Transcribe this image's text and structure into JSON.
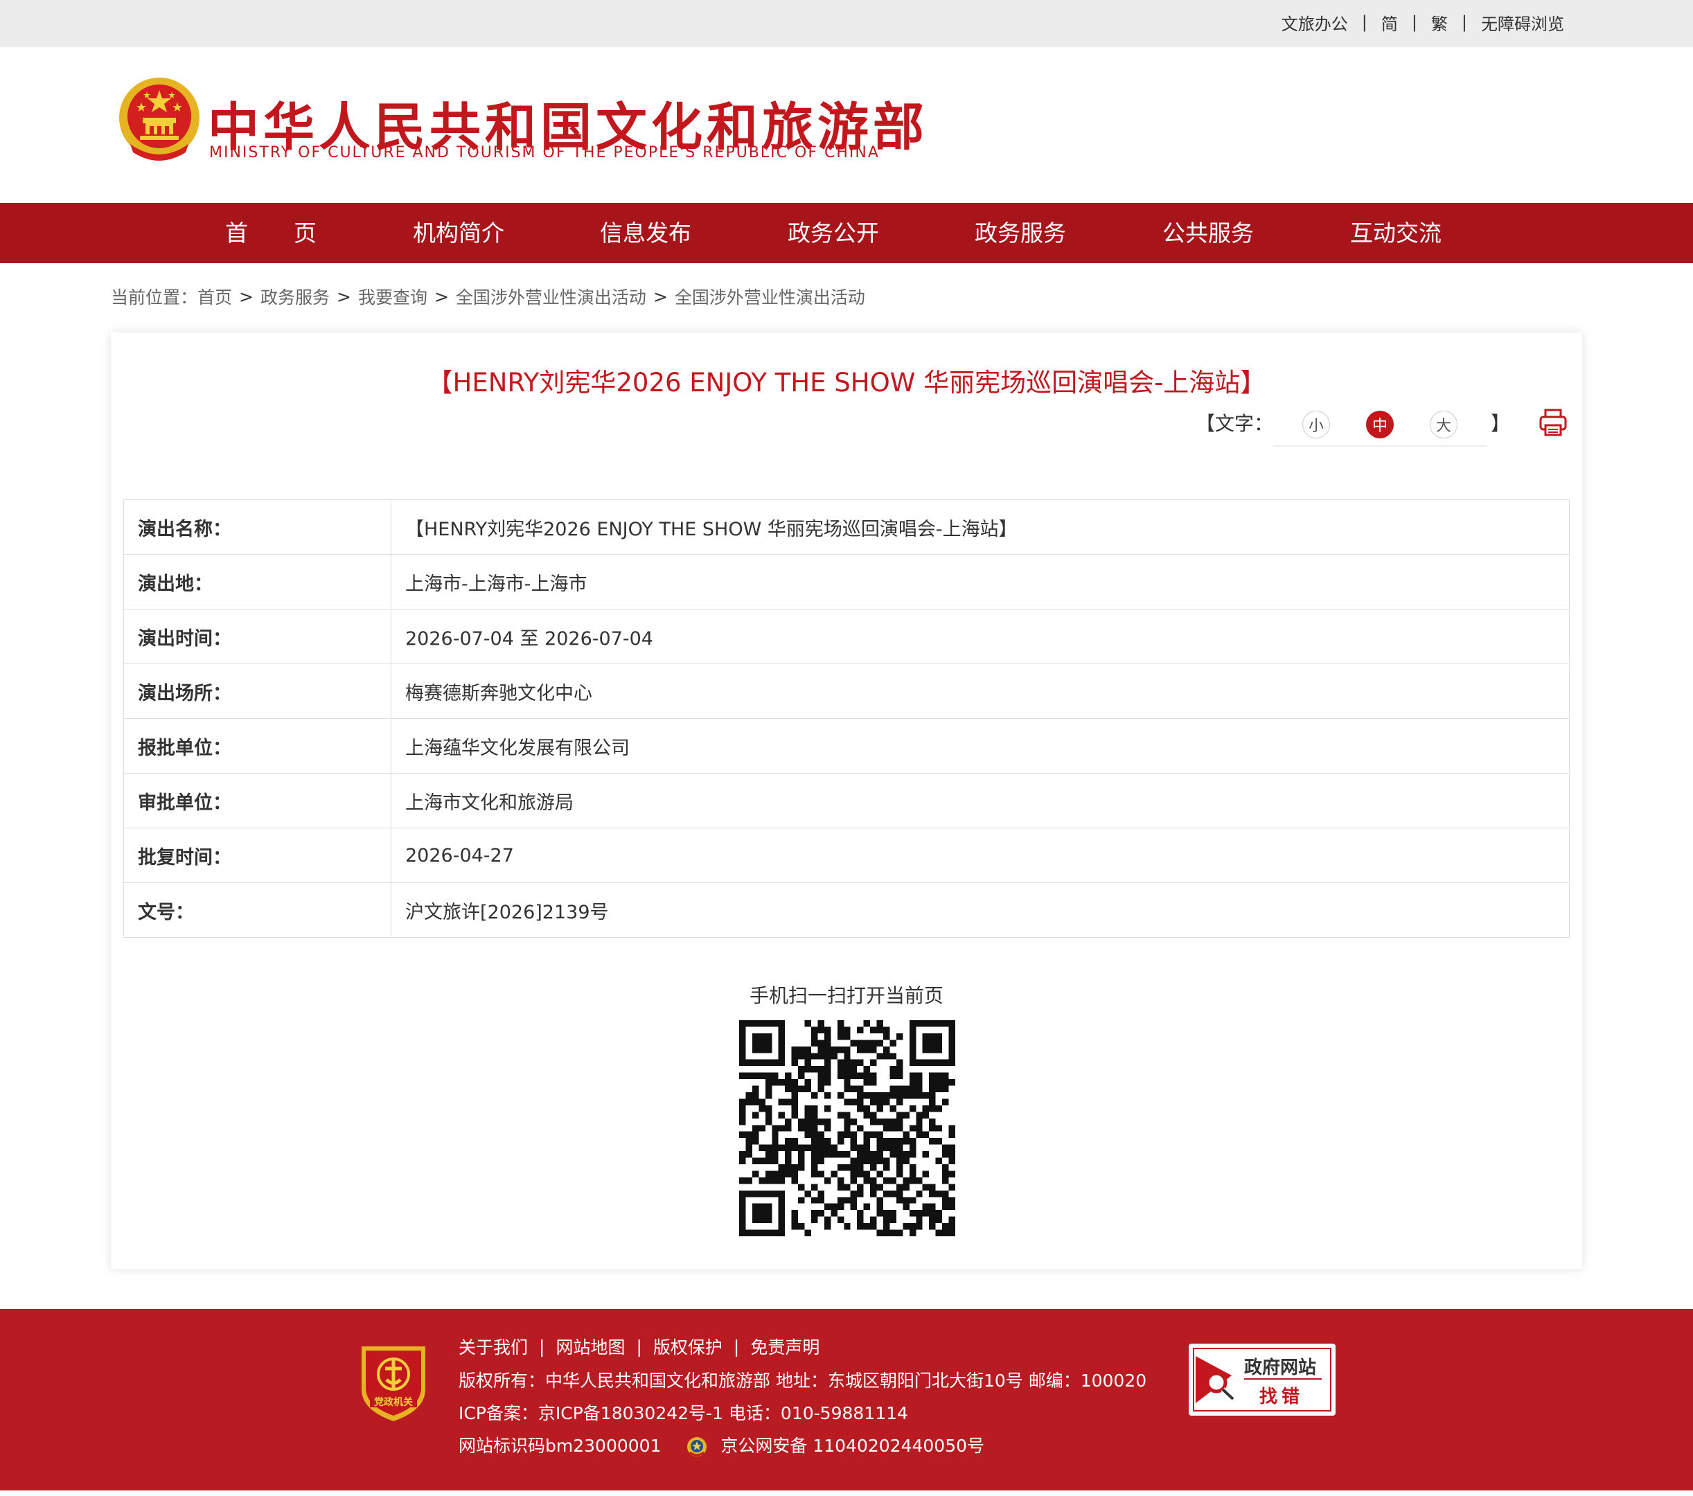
{
  "topbar": {
    "links": [
      "文旅办公",
      "简",
      "繁",
      "无障碍浏览"
    ],
    "separator": "|"
  },
  "header": {
    "title": "中华人民共和国文化和旅游部",
    "subtitle": "MINISTRY OF CULTURE AND TOURISM OF THE PEOPLE'S REPUBLIC OF CHINA"
  },
  "nav": {
    "items": [
      "首　　页",
      "机构简介",
      "信息发布",
      "政务公开",
      "政务服务",
      "公共服务",
      "互动交流"
    ]
  },
  "breadcrumb": {
    "prefix": "当前位置：",
    "items": [
      "首页",
      "政务服务",
      "我要查询",
      "全国涉外营业性演出活动",
      "全国涉外营业性演出活动"
    ],
    "arrow": ">"
  },
  "article": {
    "title": "【HENRY刘宪华2026 ENJOY THE SHOW 华丽宪场巡回演唱会-上海站】",
    "font_label": "【文字：",
    "font_close": "】",
    "font_sizes": [
      "小",
      "中",
      "大"
    ],
    "font_active": "中"
  },
  "details": [
    {
      "label": "演出名称：",
      "value": "【HENRY刘宪华2026 ENJOY THE SHOW 华丽宪场巡回演唱会-上海站】"
    },
    {
      "label": "演出地：",
      "value": "上海市-上海市-上海市"
    },
    {
      "label": "演出时间：",
      "value": "2026-07-04 至 2026-07-04"
    },
    {
      "label": "演出场所：",
      "value": "梅赛德斯奔驰文化中心"
    },
    {
      "label": "报批单位：",
      "value": "上海蕴华文化发展有限公司"
    },
    {
      "label": "审批单位：",
      "value": "上海市文化和旅游局"
    },
    {
      "label": "批复时间：",
      "value": "2026-04-27"
    },
    {
      "label": "文号：",
      "value": "沪文旅许[2026]2139号"
    }
  ],
  "qr": {
    "caption": "手机扫一扫打开当前页"
  },
  "footer": {
    "links": [
      "关于我们",
      "网站地图",
      "版权保护",
      "免责声明"
    ],
    "separator": "|",
    "copyright": "版权所有：中华人民共和国文化和旅游部  地址：东城区朝阳门北大街10号  邮编：100020",
    "icp": "ICP备案：京ICP备18030242号-1  电话：010-59881114",
    "site_code": "网站标识码bm23000001",
    "police": "京公网安备 11040202440050号",
    "badge_text": "党政机关",
    "finderr_line1": "政府网站",
    "finderr_line2": "找错"
  },
  "colors": {
    "brand_red": "#c2171d",
    "nav_red": "#a7151b",
    "footer_red": "#b81c22"
  }
}
